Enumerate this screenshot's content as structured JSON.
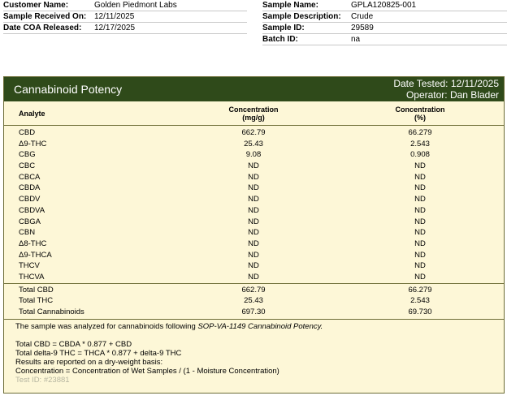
{
  "info_left": [
    {
      "label": "Customer Name:",
      "value": "Golden Piedmont Labs"
    },
    {
      "label": "Sample Received On:",
      "value": "12/11/2025"
    },
    {
      "label": "Date COA Released:",
      "value": "12/17/2025"
    }
  ],
  "info_right": [
    {
      "label": "Sample Name:",
      "value": "GPLA120825-001"
    },
    {
      "label": "Sample Description:",
      "value": "Crude"
    },
    {
      "label": "Sample ID:",
      "value": "29589"
    },
    {
      "label": "Batch ID:",
      "value": "na"
    }
  ],
  "potency": {
    "title": "Cannabinoid Potency",
    "date_tested": "Date Tested: 12/11/2025",
    "operator": "Operator: Dan Blader",
    "col_analyte": "Analyte",
    "col_mg_1": "Concentration",
    "col_mg_2": "(mg/g)",
    "col_pct_1": "Concentration",
    "col_pct_2": "(%)",
    "rows": [
      {
        "name": "CBD",
        "mg": "662.79",
        "pct": "66.279"
      },
      {
        "name": "Δ9-THC",
        "mg": "25.43",
        "pct": "2.543"
      },
      {
        "name": "CBG",
        "mg": "9.08",
        "pct": "0.908"
      },
      {
        "name": "CBC",
        "mg": "ND",
        "pct": "ND"
      },
      {
        "name": "CBCA",
        "mg": "ND",
        "pct": "ND"
      },
      {
        "name": "CBDA",
        "mg": "ND",
        "pct": "ND"
      },
      {
        "name": "CBDV",
        "mg": "ND",
        "pct": "ND"
      },
      {
        "name": "CBDVA",
        "mg": "ND",
        "pct": "ND"
      },
      {
        "name": "CBGA",
        "mg": "ND",
        "pct": "ND"
      },
      {
        "name": "CBN",
        "mg": "ND",
        "pct": "ND"
      },
      {
        "name": "Δ8-THC",
        "mg": "ND",
        "pct": "ND"
      },
      {
        "name": "Δ9-THCA",
        "mg": "ND",
        "pct": "ND"
      },
      {
        "name": "THCV",
        "mg": "ND",
        "pct": "ND"
      },
      {
        "name": "THCVA",
        "mg": "ND",
        "pct": "ND"
      }
    ],
    "totals": [
      {
        "name": "Total CBD",
        "mg": "662.79",
        "pct": "66.279"
      },
      {
        "name": "Total THC",
        "mg": "25.43",
        "pct": "2.543"
      },
      {
        "name": "Total Cannabinoids",
        "mg": "697.30",
        "pct": "69.730"
      }
    ],
    "note_prefix": "The sample was analyzed for cannabinoids following ",
    "note_method": "SOP-VA-1149 Cannabinoid Potency.",
    "formula_cbd": "Total CBD = CBDA * 0.877 + CBD",
    "formula_thc": "Total delta-9 THC = THCA * 0.877 + delta-9 THC",
    "dry_weight": "Results are reported on a dry-weight basis:",
    "concentration_note": "Concentration = Concentration of Wet Samples / (1 - Moisture Concentration)",
    "test_id": "Test ID: #23881"
  }
}
